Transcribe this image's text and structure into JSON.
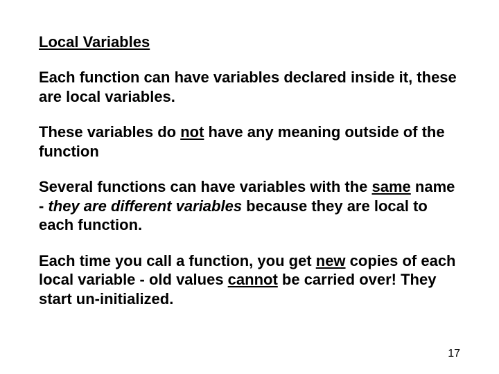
{
  "title": "Local Variables",
  "p1": "Each function can have variables declared inside it, these are local variables.",
  "p2a": "These variables do ",
  "p2u": "not",
  "p2b": " have any meaning outside of the function",
  "p3a": "Several functions can have variables with the ",
  "p3u1": "same",
  "p3b": " name - ",
  "p3i": "they are different variables",
  "p3c": " because they are local to each function.",
  "p4a": "Each time you call a function, you get ",
  "p4u1": "new",
  "p4b": " copies of each local variable - old values ",
  "p4u2": "cannot",
  "p4c": " be carried over! They start un-initialized.",
  "pagenum": "17"
}
